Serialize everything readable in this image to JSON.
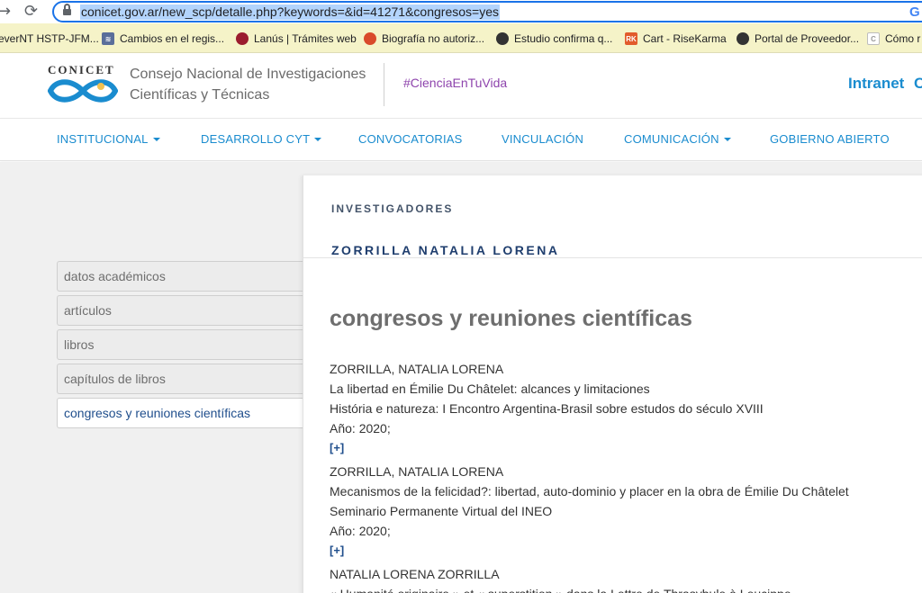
{
  "browser": {
    "url": "conicet.gov.ar/new_scp/detalle.php?keywords=&id=41271&congresos=yes",
    "bookmarks": [
      {
        "label": "everNT HSTP-JFM...",
        "icon": "",
        "icon_color": "#f5f3c8"
      },
      {
        "label": "Cambios en el regis...",
        "icon": "≋",
        "icon_color": "#5a6e9a"
      },
      {
        "label": "Lanús | Trámites web",
        "icon": "●",
        "icon_color": "#9b1c2e"
      },
      {
        "label": "Biografía no autoriz...",
        "icon": "◉",
        "icon_color": "#d94a2b"
      },
      {
        "label": "Estudio confirma q...",
        "icon": "●●",
        "icon_color": "#333333"
      },
      {
        "label": "Cart - RiseKarma",
        "icon": "RK",
        "icon_color": "#e25b2b"
      },
      {
        "label": "Portal de Proveedor...",
        "icon": "◐",
        "icon_color": "#333333"
      },
      {
        "label": "Cómo r",
        "icon": "C",
        "icon_color": "#bdbdbd"
      }
    ]
  },
  "header": {
    "logo_text": "CONICET",
    "org_line1": "Consejo Nacional de Investigaciones",
    "org_line2": "Científicas y Técnicas",
    "hashtag": "#CienciaEnTuVida",
    "intranet": "Intranet",
    "intranet_cut": "C"
  },
  "nav": {
    "items": [
      {
        "label": "INSTITUCIONAL",
        "dropdown": true
      },
      {
        "label": "DESARROLLO CYT",
        "dropdown": true
      },
      {
        "label": "CONVOCATORIAS",
        "dropdown": false
      },
      {
        "label": "VINCULACIÓN",
        "dropdown": false
      },
      {
        "label": "COMUNICACIÓN",
        "dropdown": true
      },
      {
        "label": "GOBIERNO ABIERTO",
        "dropdown": false
      }
    ]
  },
  "sidebar": {
    "items": [
      {
        "label": "datos académicos"
      },
      {
        "label": "artículos"
      },
      {
        "label": "libros"
      },
      {
        "label": "capítulos de libros"
      },
      {
        "label": "congresos y reuniones científicas",
        "active": true
      }
    ]
  },
  "main": {
    "section_label": "INVESTIGADORES",
    "researcher_name": "ZORRILLA NATALIA LORENA",
    "section_title": "congresos y reuniones científicas",
    "entries": [
      {
        "author": "ZORRILLA, NATALIA LORENA",
        "title": "La libertad en Émilie Du Châtelet: alcances y limitaciones",
        "event": "História e natureza: I Encontro Argentina-Brasil sobre estudos do século XVIII",
        "year": "Año: 2020;",
        "more": "[+]"
      },
      {
        "author": "ZORRILLA, NATALIA LORENA",
        "title": "Mecanismos de la felicidad?: libertad, auto-dominio y placer en la obra de Émilie Du Châtelet",
        "event": "Seminario Permanente Virtual del INEO",
        "year": "Año: 2020;",
        "more": "[+]"
      },
      {
        "author": "NATALIA LORENA ZORRILLA",
        "title": "« Humanité originaire » et « superstition » dans la Lettre de Thrasybule à Leucippe"
      }
    ]
  },
  "colors": {
    "accent": "#1a8ccf",
    "hashtag": "#8e44ad",
    "dark_blue": "#1f4e8c",
    "bookmark_bar": "#f5f3c8"
  }
}
